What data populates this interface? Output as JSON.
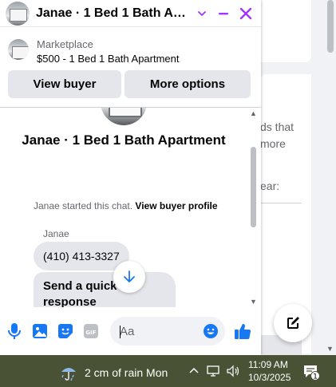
{
  "chat": {
    "title": "Janae · 1 Bed 1 Bath Apart…",
    "marketplace_label": "Marketplace",
    "listing": "$500 - 1 Bed 1 Bath Apartment",
    "view_buyer": "View buyer",
    "more_options": "More options",
    "conversation_title": "Janae · 1 Bed 1 Bath Apartment",
    "started_text": "Janae started this chat.",
    "view_buyer_profile": "View buyer profile",
    "sender": "Janae",
    "message": "(410) 413-3327",
    "quick_response": "Send a quick response",
    "input_placeholder": "Aa",
    "accent": "#a033ff",
    "composer_color": "#1877f2"
  },
  "background": {
    "snippet1": "ds that",
    "snippet2": "more",
    "snippet3": "ear:"
  },
  "taskbar": {
    "weather": "2 cm of rain Mon",
    "time": "11:09 AM",
    "date": "10/3/2025",
    "notification_count": "1"
  }
}
